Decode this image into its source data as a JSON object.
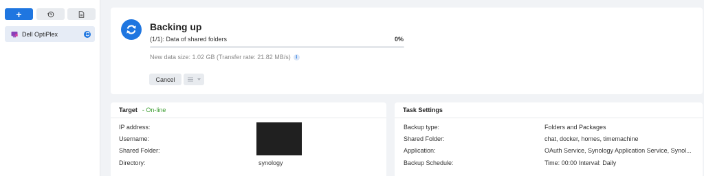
{
  "sidebar": {
    "add_label": "+",
    "history_icon": "history-icon",
    "log_icon": "document-icon",
    "task": {
      "name": "Dell OptiPlex",
      "icon": "computer-icon",
      "status_icon": "sync-icon"
    }
  },
  "status": {
    "title": "Backing up",
    "progress_label": "(1/1): Data of shared folders",
    "progress_percent_text": "0%",
    "progress_fraction": 0,
    "data_size": "New data size: 1.02 GB (Transfer rate: 21.82 MB/s)",
    "info_label": "i",
    "cancel_label": "Cancel"
  },
  "target": {
    "title": "Target",
    "status": "- On-line",
    "rows": [
      {
        "label": "IP address:",
        "value": ""
      },
      {
        "label": "Username:",
        "value": ""
      },
      {
        "label": "Shared Folder:",
        "value": ""
      },
      {
        "label": "Directory:",
        "value": "synology"
      }
    ]
  },
  "task_settings": {
    "title": "Task Settings",
    "rows": [
      {
        "label": "Backup type:",
        "value": "Folders and Packages"
      },
      {
        "label": "Shared Folder:",
        "value": "chat, docker, homes, timemachine"
      },
      {
        "label": "Application:",
        "value": "OAuth Service, Synology Application Service, Synol..."
      },
      {
        "label": "Backup Schedule:",
        "value": "Time: 00:00 Interval: Daily"
      }
    ]
  },
  "colors": {
    "accent": "#1f76e0",
    "online": "#3b9c2f"
  }
}
